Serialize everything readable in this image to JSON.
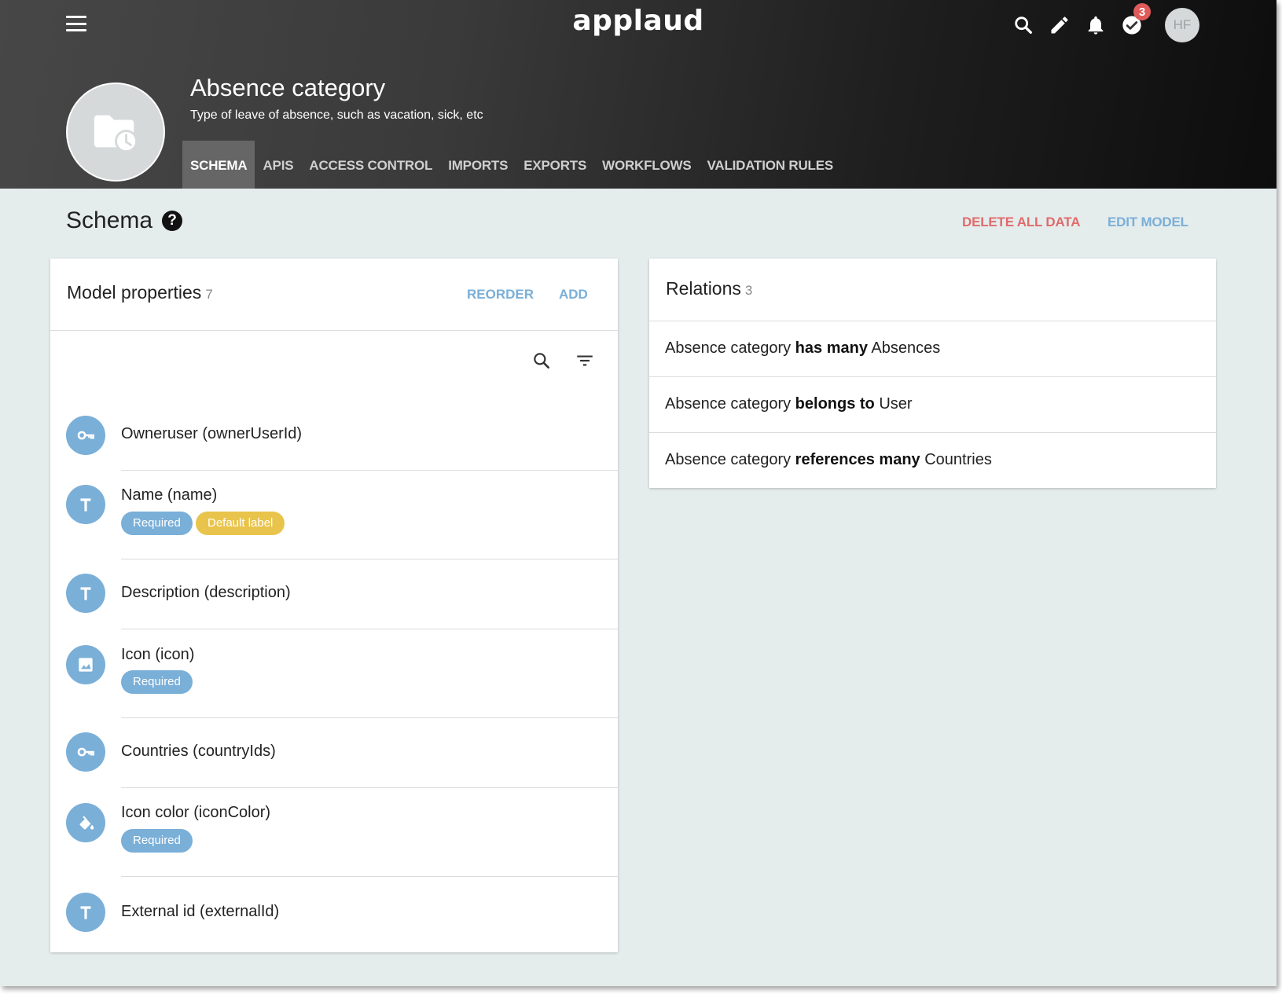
{
  "app": {
    "logo": "applaud"
  },
  "header": {
    "notification_count": "3",
    "user_initials": "HF",
    "icons": [
      "menu-icon",
      "search-icon",
      "pencil-icon",
      "bell-icon",
      "check-circle-icon"
    ]
  },
  "model": {
    "title": "Absence category",
    "description": "Type of leave of absence, such as vacation, sick, etc",
    "avatar_icon": "folder-clock-icon"
  },
  "tabs": [
    {
      "label": "SCHEMA",
      "active": true
    },
    {
      "label": "APIS",
      "active": false
    },
    {
      "label": "ACCESS CONTROL",
      "active": false
    },
    {
      "label": "IMPORTS",
      "active": false
    },
    {
      "label": "EXPORTS",
      "active": false
    },
    {
      "label": "WORKFLOWS",
      "active": false
    },
    {
      "label": "VALIDATION RULES",
      "active": false
    }
  ],
  "section": {
    "title": "Schema",
    "help": "?",
    "delete_all_label": "DELETE ALL DATA",
    "edit_model_label": "EDIT MODEL"
  },
  "properties_card": {
    "title": "Model properties",
    "count": "7",
    "reorder_label": "REORDER",
    "add_label": "ADD",
    "items": [
      {
        "label": "Owneruser (ownerUserId)",
        "icon": "key-icon",
        "chips": []
      },
      {
        "label": "Name (name)",
        "icon": "text-icon",
        "chips": [
          "Required",
          "Default label"
        ]
      },
      {
        "label": "Description (description)",
        "icon": "text-icon",
        "chips": []
      },
      {
        "label": "Icon (icon)",
        "icon": "image-icon",
        "chips": [
          "Required"
        ]
      },
      {
        "label": "Countries (countryIds)",
        "icon": "key-icon",
        "chips": []
      },
      {
        "label": "Icon color (iconColor)",
        "icon": "paint-bucket-icon",
        "chips": [
          "Required"
        ]
      },
      {
        "label": "External id (externalId)",
        "icon": "text-icon",
        "chips": []
      }
    ]
  },
  "relations_card": {
    "title": "Relations",
    "count": "3",
    "items": [
      {
        "subject": "Absence category",
        "verb": "has many",
        "object": "Absences"
      },
      {
        "subject": "Absence category",
        "verb": "belongs to",
        "object": "User"
      },
      {
        "subject": "Absence category",
        "verb": "references many",
        "object": "Countries"
      }
    ]
  },
  "colors": {
    "accent_blue": "#7aafd8",
    "danger_red": "#e06b6b",
    "chip_yellow": "#e9c44c",
    "badge_red": "#e05a5a",
    "page_bg": "#e5ecec"
  }
}
